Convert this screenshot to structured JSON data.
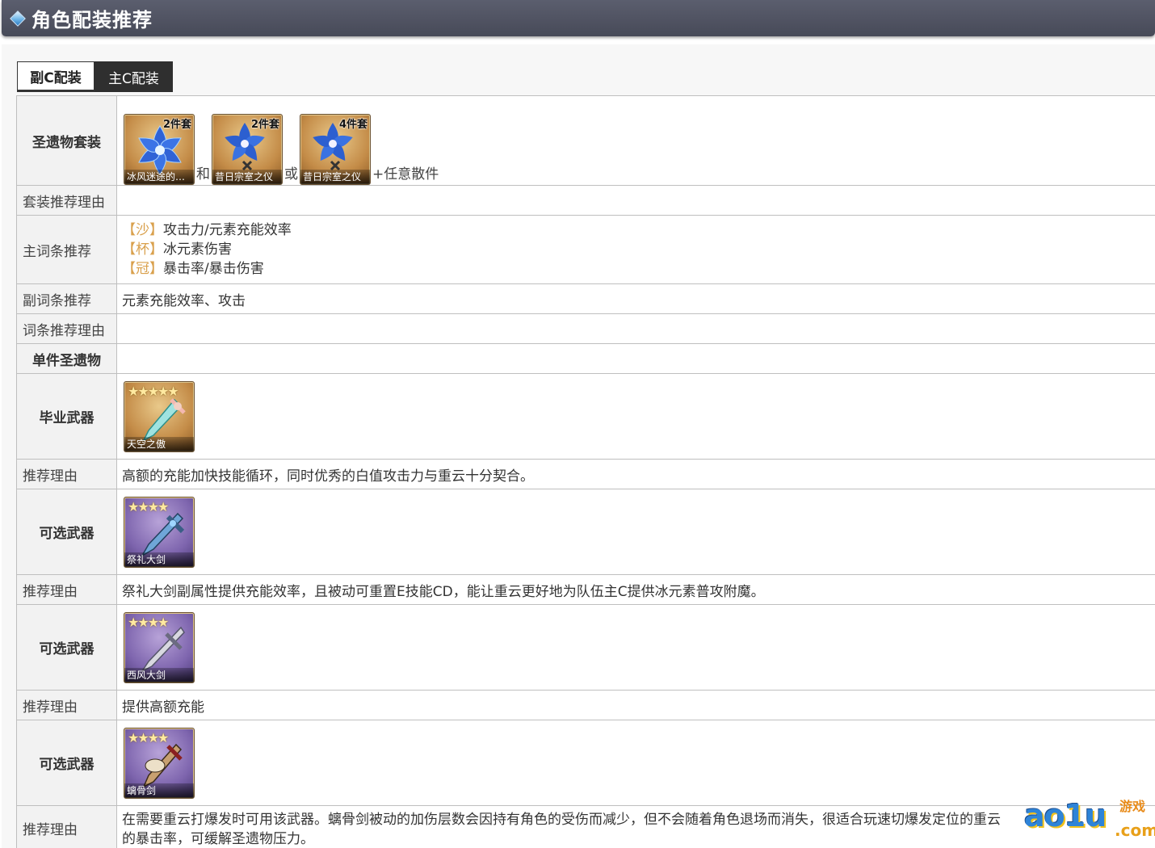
{
  "header": {
    "title": "角色配装推荐"
  },
  "tabs": [
    {
      "label": "副C配装",
      "active": true
    },
    {
      "label": "主C配装",
      "active": false
    }
  ],
  "artifact_set": {
    "label": "圣遗物套装",
    "items": [
      {
        "name": "冰风迷途的…",
        "badge": "2件套",
        "icon": "blue-flower-icon"
      },
      {
        "name": "昔日宗室之仪",
        "badge": "2件套",
        "icon": "blue-flower-crest-icon"
      },
      {
        "name": "昔日宗室之仪",
        "badge": "4件套",
        "icon": "blue-flower-crest-icon"
      }
    ],
    "joiner_and": "和",
    "joiner_or": "或",
    "suffix": "+任意散件"
  },
  "set_reason": {
    "label": "套装推荐理由",
    "value": ""
  },
  "main_stats": {
    "label": "主词条推荐",
    "lines": [
      {
        "tag": "【沙】",
        "text": "攻击力/元素充能效率"
      },
      {
        "tag": "【杯】",
        "text": "冰元素伤害"
      },
      {
        "tag": "【冠】",
        "text": "暴击率/暴击伤害"
      }
    ]
  },
  "sub_stats": {
    "label": "副词条推荐",
    "value": "元素充能效率、攻击"
  },
  "stat_reason": {
    "label": "词条推荐理由",
    "value": ""
  },
  "single_artifact": {
    "label": "单件圣遗物",
    "value": ""
  },
  "weapons": [
    {
      "label": "毕业武器",
      "name": "天空之傲",
      "rarity": 5,
      "stars": "★★★★★",
      "reason_label": "推荐理由",
      "reason": "高额的充能加快技能循环，同时优秀的白值攻击力与重云十分契合。"
    },
    {
      "label": "可选武器",
      "name": "祭礼大剑",
      "rarity": 4,
      "stars": "★★★★",
      "reason_label": "推荐理由",
      "reason": "祭礼大剑副属性提供充能效率，且被动可重置E技能CD，能让重云更好地为队伍主C提供冰元素普攻附魔。"
    },
    {
      "label": "可选武器",
      "name": "西风大剑",
      "rarity": 4,
      "stars": "★★★★",
      "reason_label": "推荐理由",
      "reason": "提供高额充能"
    },
    {
      "label": "可选武器",
      "name": "螭骨剑",
      "rarity": 4,
      "stars": "★★★★",
      "reason_label": "推荐理由",
      "reason": "在需要重云打爆发时可用该武器。螭骨剑被动的加伤层数会因持有角色的受伤而减少，但不会随着角色退场而消失，很适合玩速切爆发定位的重云",
      "reason_line2": "的暴击率，可缓解圣遗物压力。"
    }
  ],
  "watermark": {
    "text": "ao1u",
    "sub": "游戏",
    "com": ".com"
  }
}
